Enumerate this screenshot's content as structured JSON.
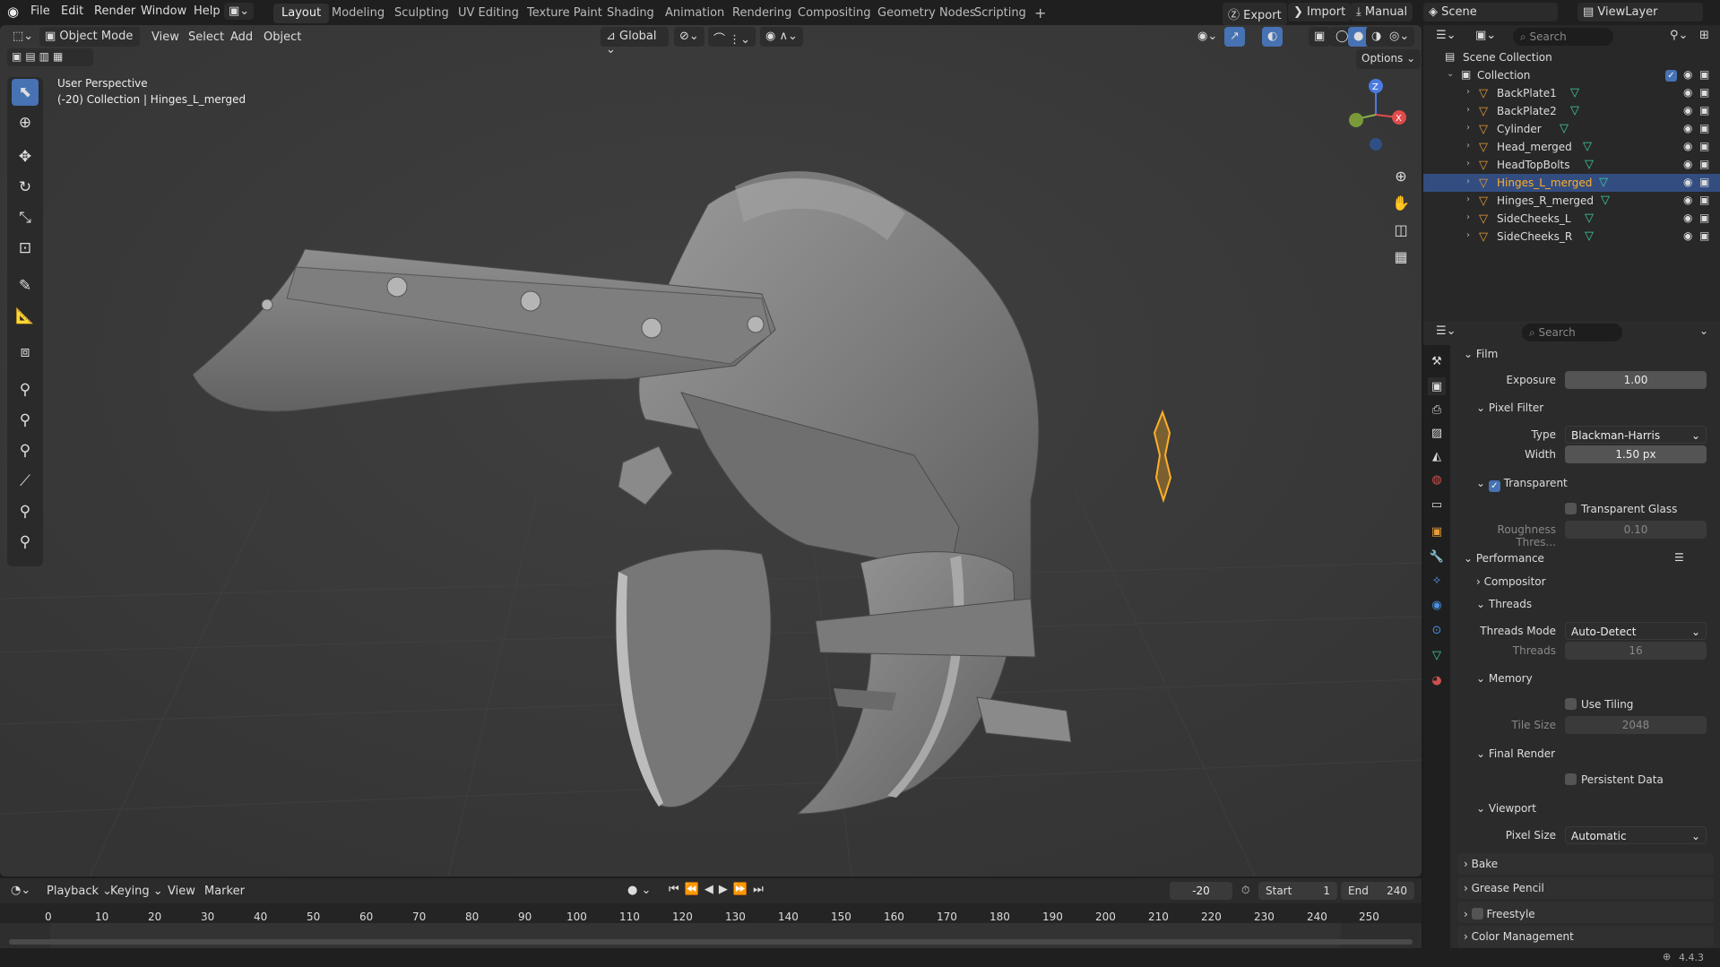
{
  "topbar": {
    "menus": [
      "File",
      "Edit",
      "Render",
      "Window",
      "Help"
    ],
    "workspaces": [
      "Layout",
      "Modeling",
      "Sculpting",
      "UV Editing",
      "Texture Paint",
      "Shading",
      "Animation",
      "Rendering",
      "Compositing",
      "Geometry Nodes",
      "Scripting"
    ],
    "active_workspace": "Layout",
    "export_label": "Export",
    "import_label": "Import",
    "manual_label": "Manual",
    "scene_label": "Scene",
    "viewlayer_label": "ViewLayer"
  },
  "viewport": {
    "mode": "Object Mode",
    "menus": [
      "View",
      "Select",
      "Add",
      "Object"
    ],
    "transform_orientation": "Global",
    "options_label": "Options",
    "overlay_title": "User Perspective",
    "overlay_subtitle": "(-20) Collection | Hinges_L_merged",
    "gizmo_axes": [
      "Z",
      "X"
    ]
  },
  "outliner": {
    "search_placeholder": "Search",
    "scene_collection": "Scene Collection",
    "collection": "Collection",
    "objects": [
      {
        "name": "BackPlate1",
        "selected": false
      },
      {
        "name": "BackPlate2",
        "selected": false
      },
      {
        "name": "Cylinder",
        "selected": false
      },
      {
        "name": "Head_merged",
        "selected": false
      },
      {
        "name": "HeadTopBolts",
        "selected": false
      },
      {
        "name": "Hinges_L_merged",
        "selected": true
      },
      {
        "name": "Hinges_R_merged",
        "selected": false
      },
      {
        "name": "SideCheeks_L",
        "selected": false
      },
      {
        "name": "SideCheeks_R",
        "selected": false
      }
    ]
  },
  "properties": {
    "search_placeholder": "Search",
    "film": "Film",
    "exposure_label": "Exposure",
    "exposure_value": "1.00",
    "pixel_filter": "Pixel Filter",
    "type_label": "Type",
    "type_value": "Blackman-Harris",
    "width_label": "Width",
    "width_value": "1.50 px",
    "transparent": "Transparent",
    "transparent_glass": "Transparent Glass",
    "roughness_label": "Roughness Thres...",
    "roughness_value": "0.10",
    "performance": "Performance",
    "compositor": "Compositor",
    "threads": "Threads",
    "threads_mode_label": "Threads Mode",
    "threads_mode_value": "Auto-Detect",
    "threads_label": "Threads",
    "threads_value": "16",
    "memory": "Memory",
    "use_tiling": "Use Tiling",
    "tile_size_label": "Tile Size",
    "tile_size_value": "2048",
    "final_render": "Final Render",
    "persistent_data": "Persistent Data",
    "viewport_section": "Viewport",
    "pixel_size_label": "Pixel Size",
    "pixel_size_value": "Automatic",
    "bake": "Bake",
    "grease_pencil": "Grease Pencil",
    "freestyle": "Freestyle",
    "color_management": "Color Management"
  },
  "timeline": {
    "menus": [
      "Playback",
      "Keying",
      "View",
      "Marker"
    ],
    "current_frame": "-20",
    "start_label": "Start",
    "start_value": "1",
    "end_label": "End",
    "end_value": "240",
    "ticks": [
      "0",
      "10",
      "20",
      "30",
      "40",
      "50",
      "60",
      "70",
      "80",
      "90",
      "100",
      "110",
      "120",
      "130",
      "140",
      "150",
      "160",
      "170",
      "180",
      "190",
      "200",
      "210",
      "220",
      "230",
      "240",
      "250"
    ]
  },
  "statusbar": {
    "version": "4.4.3"
  },
  "colors": {
    "accent": "#4772b3",
    "selected_row": "#334d80",
    "object_orange": "#e59c3a",
    "mesh_green": "#3ecfa4",
    "selected_text": "#ffaf29"
  }
}
